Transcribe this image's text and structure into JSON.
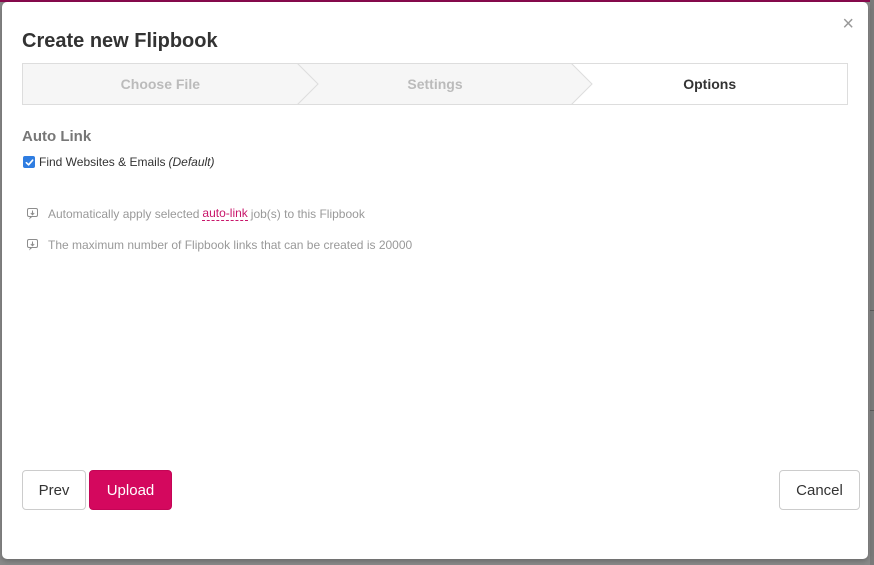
{
  "dialog": {
    "title": "Create new Flipbook",
    "close_symbol": "×"
  },
  "steps": [
    {
      "label": "Choose File",
      "state": "inactive"
    },
    {
      "label": "Settings",
      "state": "inactive"
    },
    {
      "label": "Options",
      "state": "active"
    }
  ],
  "auto_link": {
    "title": "Auto Link",
    "checkbox": {
      "label": "Find Websites & Emails",
      "suffix": "(Default)",
      "checked": true
    },
    "info_1": {
      "prefix": "Automatically apply selected",
      "link": "auto-link",
      "suffix": "job(s) to this Flipbook"
    },
    "info_2": "The maximum number of Flipbook links that can be created is 20000"
  },
  "footer": {
    "prev_label": "Prev",
    "upload_label": "Upload",
    "cancel_label": "Cancel"
  },
  "colors": {
    "accent": "#d4085e",
    "link": "#c8166a",
    "checkbox": "#2f7de1"
  },
  "icons": {
    "close": "close-icon",
    "checkmark": "checkmark-icon",
    "info": "info-download-icon"
  }
}
